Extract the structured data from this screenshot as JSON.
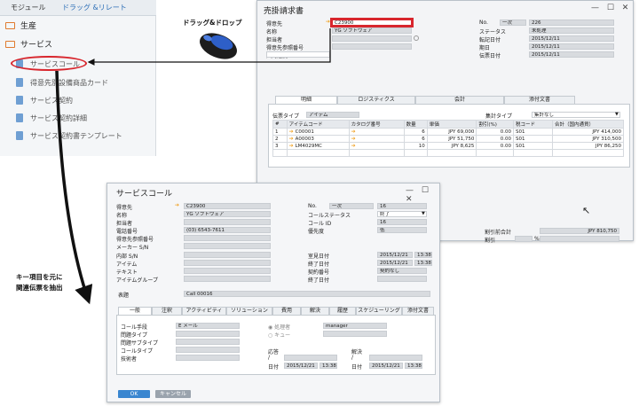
{
  "nav": {
    "tabs": [
      "モジュール",
      "ドラッグ &リレート"
    ],
    "folders": [
      "生産",
      "サービス"
    ],
    "items": [
      "サービスコール",
      "得意先別設備商品カード",
      "サービス契約",
      "サービス契約詳細",
      "サービス契約書テンプレート"
    ]
  },
  "invoice": {
    "title": "売掛請求書",
    "labels_left": [
      "得意先",
      "名称",
      "担当者",
      "得意先参照番号",
      "国内速度"
    ],
    "values_left": [
      "C23900",
      "YG ソフトウェア",
      "",
      "",
      ""
    ],
    "labels_right": [
      "No.",
      "ステータス",
      "転記日付",
      "期日",
      "伝票日付"
    ],
    "series": "一次",
    "values_right": [
      "226",
      "未処理",
      "2015/12/11",
      "2015/12/11",
      "2015/12/11"
    ],
    "tabs": [
      "明細",
      "ロジスティクス",
      "会計",
      "添付文書"
    ],
    "doc_type_label": "伝票タイプ",
    "doc_type": "アイテム",
    "summary_type_label": "集計タイプ",
    "summary_type": "集計なし",
    "grid": {
      "headers": [
        "#",
        "アイテムコード",
        "カタログ番号",
        "数量",
        "単価",
        "割引(%)",
        "税コード",
        "合計（国内通貨）"
      ],
      "rows": [
        [
          "1",
          "C00001",
          "",
          "6",
          "JPY 69,000",
          "0.00",
          "S01",
          "JPY 414,000"
        ],
        [
          "2",
          "A00003",
          "",
          "6",
          "JPY 51,750",
          "0.00",
          "S01",
          "JPY 310,500"
        ],
        [
          "3",
          "LM4029MC",
          "",
          "10",
          "JPY 8,625",
          "0.00",
          "S01",
          "JPY 86,250"
        ]
      ]
    },
    "total_label": "割引前合計",
    "total_value": "JPY 810,750",
    "discount_label": "割引",
    "percent": "%"
  },
  "callouts": {
    "drag_drop": "ドラッグ&ドロップ",
    "note_line1": "キー項目を元に",
    "note_line2": "関連伝票を抽出"
  },
  "service": {
    "title": "サービスコール",
    "labels_left": [
      "得意先",
      "名称",
      "担当者",
      "電話番号",
      "得意先参照番号",
      "メーカー S/N",
      "内部 S/N",
      "アイテム",
      "テキスト",
      "アイテムグループ"
    ],
    "values_left": [
      "C23900",
      "YG ソフトウェア",
      "",
      "(03) 6543-7611",
      "",
      "",
      "",
      "",
      "",
      ""
    ],
    "labels_right": [
      "No.",
      "コールステータス",
      "コール ID",
      "優先度",
      "",
      "室見日付",
      "終了日付",
      "契約番号",
      "終了日付"
    ],
    "series": "一次",
    "values_right": [
      "16",
      "終了",
      "16",
      "低",
      "",
      "2015/12/21",
      "2015/12/21",
      "契約なし",
      ""
    ],
    "times": [
      "13:38",
      "13:38"
    ],
    "subject_label": "表題",
    "subject": "Call 00016",
    "tabs": [
      "一般",
      "注釈",
      "アクティビティ",
      "ソリューション",
      "費用",
      "解決",
      "履歴",
      "スケジューリング",
      "添付文書"
    ],
    "general_labels": [
      "コール手段",
      "問題タイプ",
      "問題サブタイプ",
      "コールタイプ",
      "技術者"
    ],
    "origin": "E メール",
    "radio_handler": "処理者",
    "radio_queue": "キュー",
    "handler": "manager",
    "response_label": "応答",
    "resolution_label": "解決",
    "slash": "/",
    "date_label": "日付",
    "response_date": "2015/12/21",
    "response_time": "13:38",
    "resolution_date": "2015/12/21",
    "resolution_time": "13:38",
    "ok": "OK",
    "cancel": "キャンセル"
  }
}
